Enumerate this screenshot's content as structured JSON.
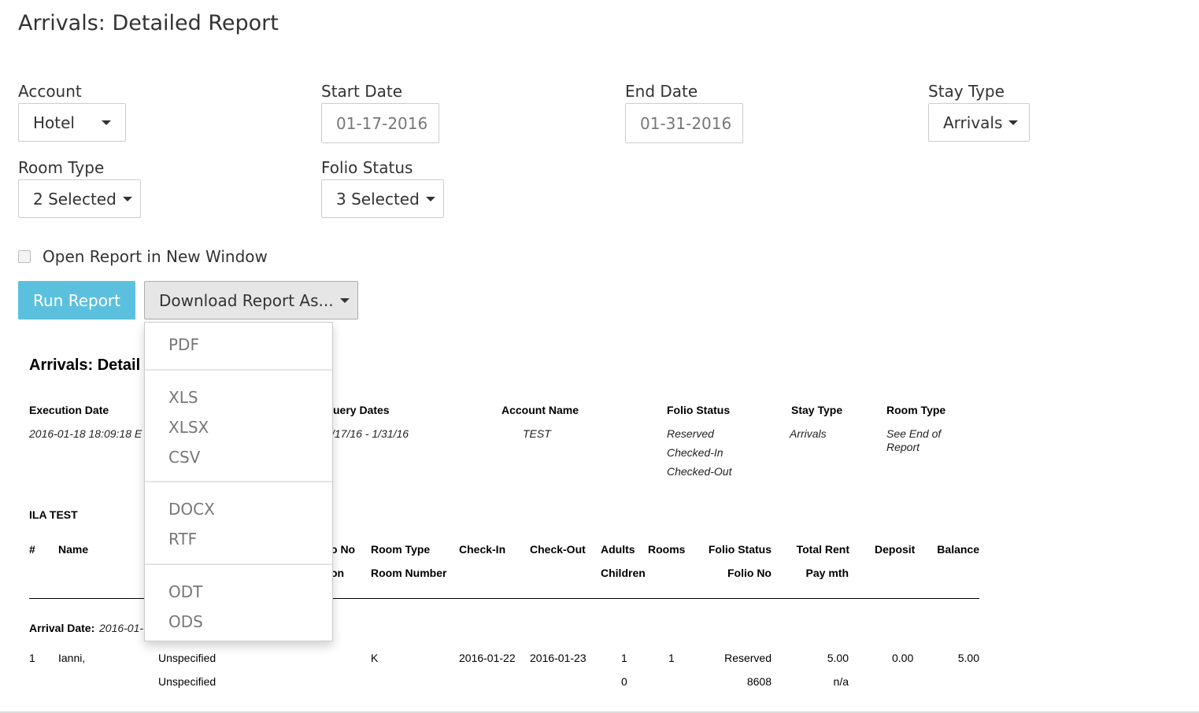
{
  "title": "Arrivals: Detailed Report",
  "form": {
    "account": {
      "label": "Account",
      "value": "Hotel"
    },
    "start_date": {
      "label": "Start Date",
      "value": "01-17-2016"
    },
    "end_date": {
      "label": "End Date",
      "value": "01-31-2016"
    },
    "stay_type": {
      "label": "Stay Type",
      "value": "Arrivals"
    },
    "room_type": {
      "label": "Room Type",
      "value": "2 Selected"
    },
    "folio_status": {
      "label": "Folio Status",
      "value": "3 Selected"
    },
    "open_new_window": {
      "label": "Open Report in New Window",
      "checked": false
    },
    "run_label": "Run Report",
    "download_label": "Download Report As...",
    "download_menu": [
      "PDF",
      "XLS",
      "XLSX",
      "CSV",
      "DOCX",
      "RTF",
      "ODT",
      "ODS"
    ]
  },
  "report": {
    "title": "Arrivals: Detail",
    "meta_headers": [
      "Execution Date",
      "uery Dates",
      "Account Name",
      "Folio Status",
      "Stay Type",
      "Room Type"
    ],
    "execution_date": "2016-01-18 18:09:18 E",
    "query_dates": "/17/16 - 1/31/16",
    "account_name": "TEST",
    "folio_statuses": [
      "Reserved",
      "Checked-In",
      "Checked-Out"
    ],
    "stay_type": "Arrivals",
    "room_type": "See End of Report",
    "group": "ILA TEST",
    "columns": {
      "num": "#",
      "name": "Name",
      "folio_no_partial": "o No",
      "on_partial": "on",
      "room_type": "Room Type",
      "room_number": "Room Number",
      "check_in": "Check-In",
      "check_out": "Check-Out",
      "adults": "Adults",
      "children": "Children",
      "rooms": "Rooms",
      "folio_status": "Folio Status",
      "folio_no": "Folio No",
      "total_rent": "Total Rent",
      "pay_mth": "Pay mth",
      "deposit": "Deposit",
      "balance": "Balance"
    },
    "arrival_label": "Arrival Date:",
    "arrival_value": "2016-01-",
    "row": {
      "num": "1",
      "name": "Ianni,",
      "unspec1": "Unspecified",
      "unspec2": "Unspecified",
      "room_type": "K",
      "check_in": "2016-01-22",
      "check_out": "2016-01-23",
      "adults": "1",
      "children": "0",
      "rooms": "1",
      "folio_status": "Reserved",
      "folio_no": "8608",
      "total_rent": "5.00",
      "pay_mth": "n/a",
      "deposit": "0.00",
      "balance": "5.00"
    }
  }
}
